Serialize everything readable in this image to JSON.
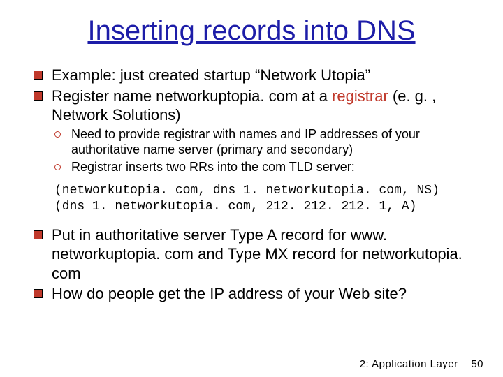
{
  "title": "Inserting records into DNS",
  "bullets": {
    "b1_pre": "Example: just created startup “Network Utopia”",
    "b2_pre": "Register name networkuptopia. com at a ",
    "b2_accent": "registrar",
    "b2_post": " (e. g. , Network Solutions)",
    "s1": "Need to provide registrar with names and IP addresses of your authoritative name server (primary and secondary)",
    "s2": "Registrar inserts two RRs into the com TLD server:",
    "code_line1": "(networkutopia. com, dns 1. networkutopia. com, NS)",
    "code_line2": "(dns 1. networkutopia. com, 212. 212. 212. 1, A)",
    "b3": "Put in authoritative server Type A record for www. networkuptopia. com and Type MX record for networkutopia. com",
    "b4": "How do people get the IP address of your Web site?"
  },
  "footer": {
    "chapter": "2: Application Layer",
    "page": "50"
  }
}
